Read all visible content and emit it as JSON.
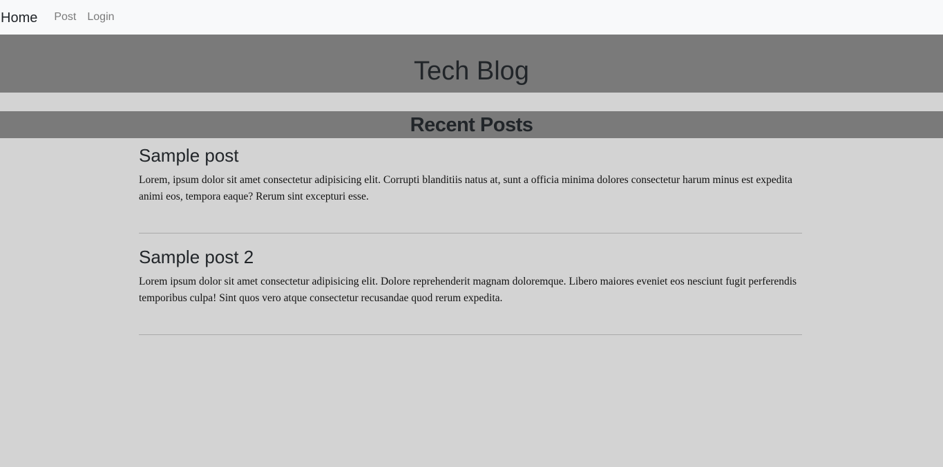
{
  "nav": {
    "brand": "Home",
    "links": [
      "Post",
      "Login"
    ]
  },
  "hero": {
    "title": "Tech Blog"
  },
  "section": {
    "title": "Recent Posts"
  },
  "posts": [
    {
      "title": "Sample post",
      "body": "Lorem, ipsum dolor sit amet consectetur adipisicing elit. Corrupti blanditiis natus at, sunt a officia minima dolores consectetur harum minus est expedita animi eos, tempora eaque? Rerum sint excepturi esse."
    },
    {
      "title": "Sample post 2",
      "body": "Lorem ipsum dolor sit amet consectetur adipisicing elit. Dolore reprehenderit magnam doloremque. Libero maiores eveniet eos nesciunt fugit perferendis temporibus culpa! Sint quos vero atque consectetur recusandae quod rerum expedita."
    }
  ],
  "colors": {
    "page_background": "#d3d3d3",
    "navbar_background": "#f8f9fa",
    "banner_background": "#7a7a7a",
    "text": "#212529",
    "nav_link": "#7a7a7a",
    "divider": "#a9a9a9"
  }
}
